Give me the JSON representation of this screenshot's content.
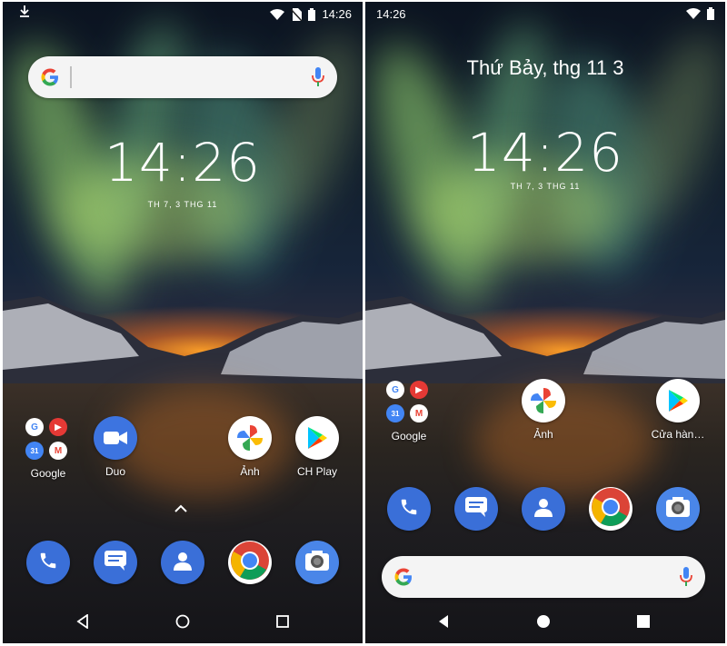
{
  "left": {
    "status_time": "14:26",
    "clock": "14:26",
    "clock_date": "TH 7, 3 THG 11",
    "apps": [
      {
        "label": "Google"
      },
      {
        "label": "Duo"
      },
      {
        "label": "Ảnh"
      },
      {
        "label": "CH Play"
      }
    ],
    "dock": [
      "phone-icon",
      "messages-icon",
      "contacts-icon",
      "chrome-icon",
      "camera-icon"
    ]
  },
  "right": {
    "status_time": "14:26",
    "date_line": "Thứ Bảy, thg 11 3",
    "clock": "14:26",
    "clock_date": "TH 7, 3 THG 11",
    "apps": [
      {
        "label": "Google"
      },
      {
        "label": "Ảnh"
      },
      {
        "label": "Cửa hàn…"
      }
    ],
    "dock": [
      "phone-icon",
      "messages-icon",
      "contacts-icon",
      "chrome-icon",
      "camera-icon"
    ]
  },
  "colors": {
    "phone_blue": "#3a6fd8",
    "camera_blue": "#4a86e8",
    "mic_blue": "#4285f4"
  }
}
